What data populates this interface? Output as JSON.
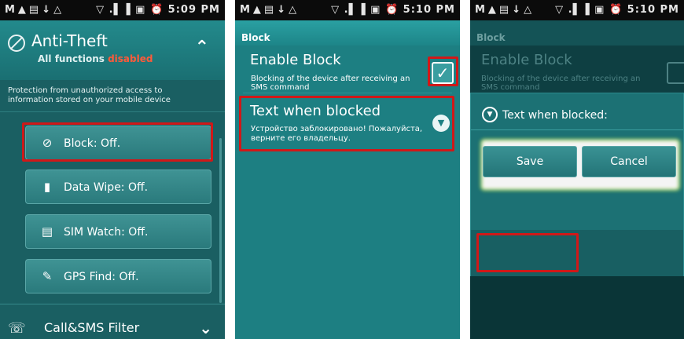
{
  "screens": [
    {
      "status": {
        "left_icons": "M▲▤↓△",
        "right_icons": "▽ .▌▐ ▣ ⏰",
        "time": "5:09 PM"
      },
      "header": {
        "title": "Anti-Theft",
        "subtitle_prefix": "All functions",
        "subtitle_state": "disabled"
      },
      "description": "Protection from unauthorized access to information stored on your mobile device",
      "buttons": [
        {
          "icon": "⊘",
          "label": "Block: Off."
        },
        {
          "icon": "▮",
          "label": "Data Wipe: Off."
        },
        {
          "icon": "▤",
          "label": "SIM Watch: Off."
        },
        {
          "icon": "✎",
          "label": "GPS Find: Off."
        }
      ],
      "next_section": {
        "icon": "☏",
        "label": "Call&SMS Filter"
      }
    },
    {
      "status": {
        "left_icons": "M▲▤↓△",
        "right_icons": "▽ .▌▐ ▣ ⏰",
        "time": "5:10 PM"
      },
      "header": "Block",
      "enable": {
        "title": "Enable Block",
        "desc": "Blocking of the device after receiving an SMS command",
        "checked": true
      },
      "text_when_blocked": {
        "title": "Text when blocked",
        "value": "Устройство заблокировано! Пожалуйста, верните его владельцу."
      }
    },
    {
      "status": {
        "left_icons": "M▲▤↓△",
        "right_icons": "▽ .▌▐ ▣ ⏰",
        "time": "5:10 PM"
      },
      "header": "Block",
      "enable": {
        "title": "Enable Block",
        "desc": "Blocking of the device after receiving an SMS command"
      },
      "dialog": {
        "title": "Text when blocked:",
        "save_label": "Save",
        "cancel_label": "Cancel"
      }
    }
  ],
  "colors": {
    "accent_red": "#d01818",
    "teal_bg": "#1d7f82",
    "disabled_red": "#ff5a3a"
  }
}
